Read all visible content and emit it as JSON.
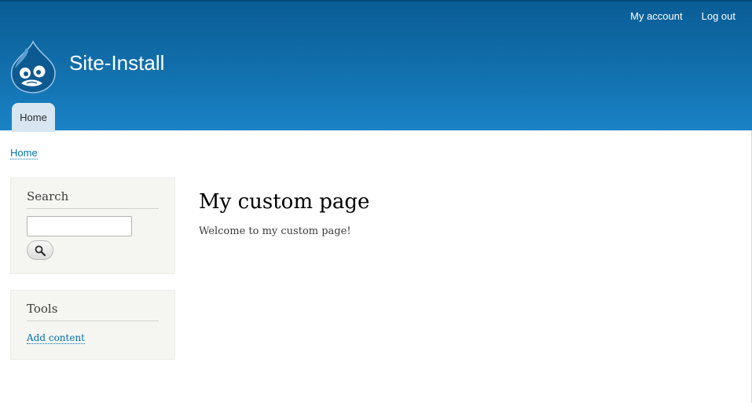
{
  "header": {
    "site_name": "Site-Install",
    "secondary_menu": {
      "my_account": "My account",
      "log_out": "Log out"
    },
    "main_menu": {
      "home": "Home"
    },
    "logo_icon": "drupal-drop-icon",
    "colors": {
      "header_top": "#0a5d96",
      "header_bottom": "#1a83c6",
      "tab_bg": "#d7e6f1"
    }
  },
  "breadcrumb": {
    "home": "Home"
  },
  "sidebar": {
    "search": {
      "title": "Search",
      "input_value": "",
      "button_icon": "search-icon"
    },
    "tools": {
      "title": "Tools",
      "add_content": "Add content"
    }
  },
  "main": {
    "title": "My custom page",
    "body": "Welcome to my custom page!"
  },
  "colors": {
    "link": "#0071b3",
    "sidebar_bg": "#f5f5f1"
  }
}
